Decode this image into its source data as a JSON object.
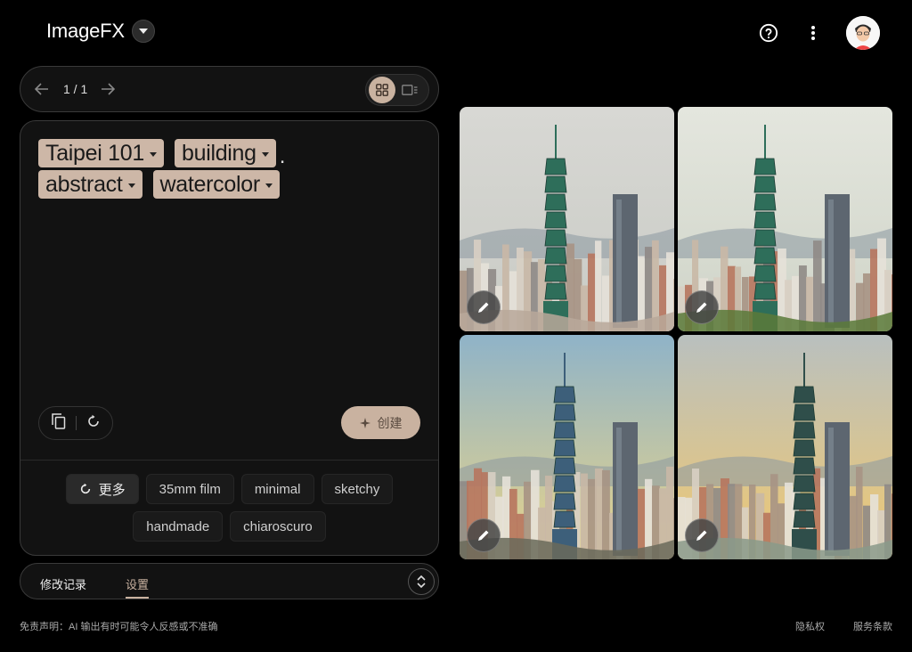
{
  "app": {
    "title": "ImageFX"
  },
  "pager": {
    "count": "1 / 1"
  },
  "prompt": {
    "rows": [
      [
        {
          "label": "Taipei 101"
        },
        {
          "label": "building"
        }
      ],
      [
        {
          "label": "abstract"
        },
        {
          "label": "watercolor"
        }
      ]
    ],
    "period": "."
  },
  "actions": {
    "create_label": "创建"
  },
  "suggestions": {
    "more_label": "更多",
    "row1": [
      "35mm film",
      "minimal",
      "sketchy"
    ],
    "row2": [
      "handmade",
      "chiaroscuro"
    ]
  },
  "tabs": {
    "history": "修改记录",
    "settings": "设置"
  },
  "footer": {
    "disclaimer": "免责声明：AI 输出有时可能令人反感或不准确",
    "privacy": "隐私权",
    "terms": "服务条款"
  },
  "colors": {
    "accent": "#c9b2a0",
    "chip": "#cdb7a7",
    "background": "#000000",
    "card": "#121212"
  },
  "images": [
    {
      "name": "image-1",
      "sky": [
        "#d8d8d4",
        "#c9cbc5"
      ],
      "tower": "#2e6e5a",
      "ground": "#b8a89a"
    },
    {
      "name": "image-2",
      "sky": [
        "#e4e6de",
        "#cfd4c8"
      ],
      "tower": "#2e6e5a",
      "ground": "#5b7a3a"
    },
    {
      "name": "image-3",
      "sky": [
        "#8fb3c8",
        "#e8d48a"
      ],
      "tower": "#3d5f7a",
      "ground": "#6a6a5a"
    },
    {
      "name": "image-4",
      "sky": [
        "#b9c0bf",
        "#f0c870"
      ],
      "tower": "#2f4e4a",
      "ground": "#8a9a8a"
    }
  ]
}
